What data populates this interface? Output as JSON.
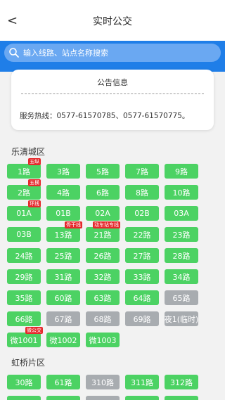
{
  "header": {
    "back": "<",
    "title": "实时公交"
  },
  "search": {
    "placeholder": "输入线路、站点名称搜索"
  },
  "notice": {
    "title": "公告信息",
    "text": "服务热线：0577-61570785、0577-61570775。"
  },
  "sections": [
    {
      "title": "乐清城区",
      "routes": [
        {
          "label": "1路",
          "tag": "五纵",
          "gray": false
        },
        {
          "label": "3路",
          "tag": "",
          "gray": false
        },
        {
          "label": "5路",
          "tag": "",
          "gray": false
        },
        {
          "label": "7路",
          "tag": "",
          "gray": false
        },
        {
          "label": "9路",
          "tag": "",
          "gray": false
        },
        {
          "label": "2路",
          "tag": "五横",
          "gray": false
        },
        {
          "label": "4路",
          "tag": "",
          "gray": false
        },
        {
          "label": "6路",
          "tag": "",
          "gray": false
        },
        {
          "label": "8路",
          "tag": "",
          "gray": false
        },
        {
          "label": "10路",
          "tag": "",
          "gray": false
        },
        {
          "label": "01A",
          "tag": "环线",
          "gray": false
        },
        {
          "label": "01B",
          "tag": "",
          "gray": false
        },
        {
          "label": "02A",
          "tag": "",
          "gray": false
        },
        {
          "label": "02B",
          "tag": "",
          "gray": false
        },
        {
          "label": "03A",
          "tag": "",
          "gray": false
        },
        {
          "label": "03B",
          "tag": "",
          "gray": false
        },
        {
          "label": "13路",
          "tag": "骨干线",
          "gray": false
        },
        {
          "label": "21路",
          "tag": "动车站专线",
          "gray": false
        },
        {
          "label": "22路",
          "tag": "",
          "gray": false
        },
        {
          "label": "23路",
          "tag": "",
          "gray": false
        },
        {
          "label": "24路",
          "tag": "",
          "gray": false
        },
        {
          "label": "25路",
          "tag": "",
          "gray": false
        },
        {
          "label": "26路",
          "tag": "",
          "gray": false
        },
        {
          "label": "27路",
          "tag": "",
          "gray": false
        },
        {
          "label": "28路",
          "tag": "",
          "gray": false
        },
        {
          "label": "29路",
          "tag": "",
          "gray": false
        },
        {
          "label": "31路",
          "tag": "",
          "gray": false
        },
        {
          "label": "32路",
          "tag": "",
          "gray": false
        },
        {
          "label": "33路",
          "tag": "",
          "gray": false
        },
        {
          "label": "34路",
          "tag": "",
          "gray": false
        },
        {
          "label": "35路",
          "tag": "",
          "gray": false
        },
        {
          "label": "60路",
          "tag": "",
          "gray": false
        },
        {
          "label": "63路",
          "tag": "",
          "gray": false
        },
        {
          "label": "64路",
          "tag": "",
          "gray": false
        },
        {
          "label": "65路",
          "tag": "",
          "gray": true
        },
        {
          "label": "66路",
          "tag": "",
          "gray": false
        },
        {
          "label": "67路",
          "tag": "",
          "gray": true
        },
        {
          "label": "68路",
          "tag": "",
          "gray": true
        },
        {
          "label": "69路",
          "tag": "",
          "gray": true
        },
        {
          "label": "夜1(临时)",
          "tag": "",
          "gray": true
        },
        {
          "label": "微1001",
          "tag": "微公交",
          "gray": false
        },
        {
          "label": "微1002",
          "tag": "",
          "gray": false
        },
        {
          "label": "微1003",
          "tag": "",
          "gray": false
        }
      ]
    },
    {
      "title": "虹桥片区",
      "routes": [
        {
          "label": "30路",
          "tag": "",
          "gray": false
        },
        {
          "label": "61路",
          "tag": "",
          "gray": false
        },
        {
          "label": "310路",
          "tag": "",
          "gray": true
        },
        {
          "label": "311路",
          "tag": "",
          "gray": false
        },
        {
          "label": "312路",
          "tag": "",
          "gray": false
        },
        {
          "label": "",
          "tag": "",
          "gray": false
        },
        {
          "label": "",
          "tag": "",
          "gray": false
        },
        {
          "label": "",
          "tag": "",
          "gray": true
        },
        {
          "label": "",
          "tag": "",
          "gray": false
        },
        {
          "label": "",
          "tag": "",
          "gray": false
        }
      ]
    }
  ],
  "colors": {
    "accent": "#1f7ee8",
    "route": "#4cd263",
    "route_disabled": "#a8acb0",
    "tag": "#e5292c"
  }
}
